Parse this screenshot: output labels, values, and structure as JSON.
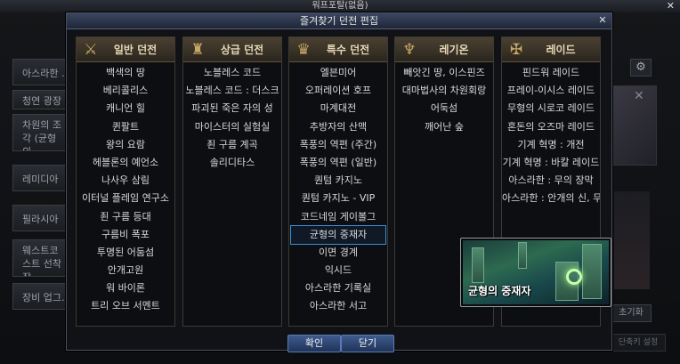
{
  "background": {
    "window_title": "워프포탈(없음)",
    "close_glyph": "✕",
    "left_items": [
      "아스라한 …",
      "청연 광장",
      "차원의 조각 (균형의 …",
      "레미디아",
      "필라시아",
      "웨스트코스트 선착장",
      "장비 업그…"
    ],
    "gear_icon": "⚙",
    "reset_label": "초기화",
    "reset2_label": "단축키 설정",
    "right_x": "✕"
  },
  "dialog": {
    "title": "즐겨찾기 던전 편집",
    "close_glyph": "✕",
    "columns": [
      {
        "title": "일반 던전",
        "icon": "swords-icon",
        "icon_glyph": "⚔",
        "items": [
          "백색의 땅",
          "베리콜리스",
          "캐니언 힐",
          "퀸팔트",
          "왕의 요람",
          "헤블론의 예언소",
          "나사우 삼림",
          "이터널 플레임 연구소",
          "죈 구름 등대",
          "구름비 폭포",
          "투명된 어둠섬",
          "안개고원",
          "워 바이론",
          "트리 오브 서멘트"
        ]
      },
      {
        "title": "상급 던전",
        "icon": "shield-icon",
        "icon_glyph": "♜",
        "items": [
          "노블레스 코드",
          "노블레스 코드 : 더스크",
          "파괴된 죽은 자의 성",
          "마이스터의 실험실",
          "죈 구름 계곡",
          "솔리디타스"
        ]
      },
      {
        "title": "특수 던전",
        "icon": "mask-icon",
        "icon_glyph": "♛",
        "items": [
          "엘븐미어",
          "오퍼레이션 호프",
          "마계대전",
          "추방자의 산맥",
          "폭풍의 역편 (주간)",
          "폭풍의 역편 (일반)",
          "퀀텀 카지노",
          "퀀텀 카지노 - VIP",
          "코드네임 게이볼그",
          "균형의 중재자",
          "이면 경계",
          "익시드",
          "아스라한 기록실",
          "아스라한 서고"
        ],
        "selected_index": 9
      },
      {
        "title": "레기온",
        "icon": "horns-icon",
        "icon_glyph": "♆",
        "items": [
          "빼앗긴 땅, 이스핀즈",
          "대마법사의 차원회랑",
          "어둑섬",
          "깨어난 숲"
        ]
      },
      {
        "title": "레이드",
        "icon": "dragon-icon",
        "icon_glyph": "✠",
        "items": [
          "핀드워 레이드",
          "프레이-이시스 레이드",
          "무형의 시로코 레이드",
          "혼돈의 오즈마 레이드",
          "기계 혁명 : 개전",
          "기계 혁명 : 바칼 레이드",
          "아스라한 : 무의 장막",
          "아스라한 : 안개의 신, 무"
        ]
      }
    ],
    "preview_label": "균형의 중재자",
    "confirm_label": "확인",
    "cancel_label": "닫기"
  },
  "colors": {
    "accent_blue": "#3d8fd6",
    "header_gold": "#e6d6b4",
    "titlebar_blue": "#3a4660"
  }
}
